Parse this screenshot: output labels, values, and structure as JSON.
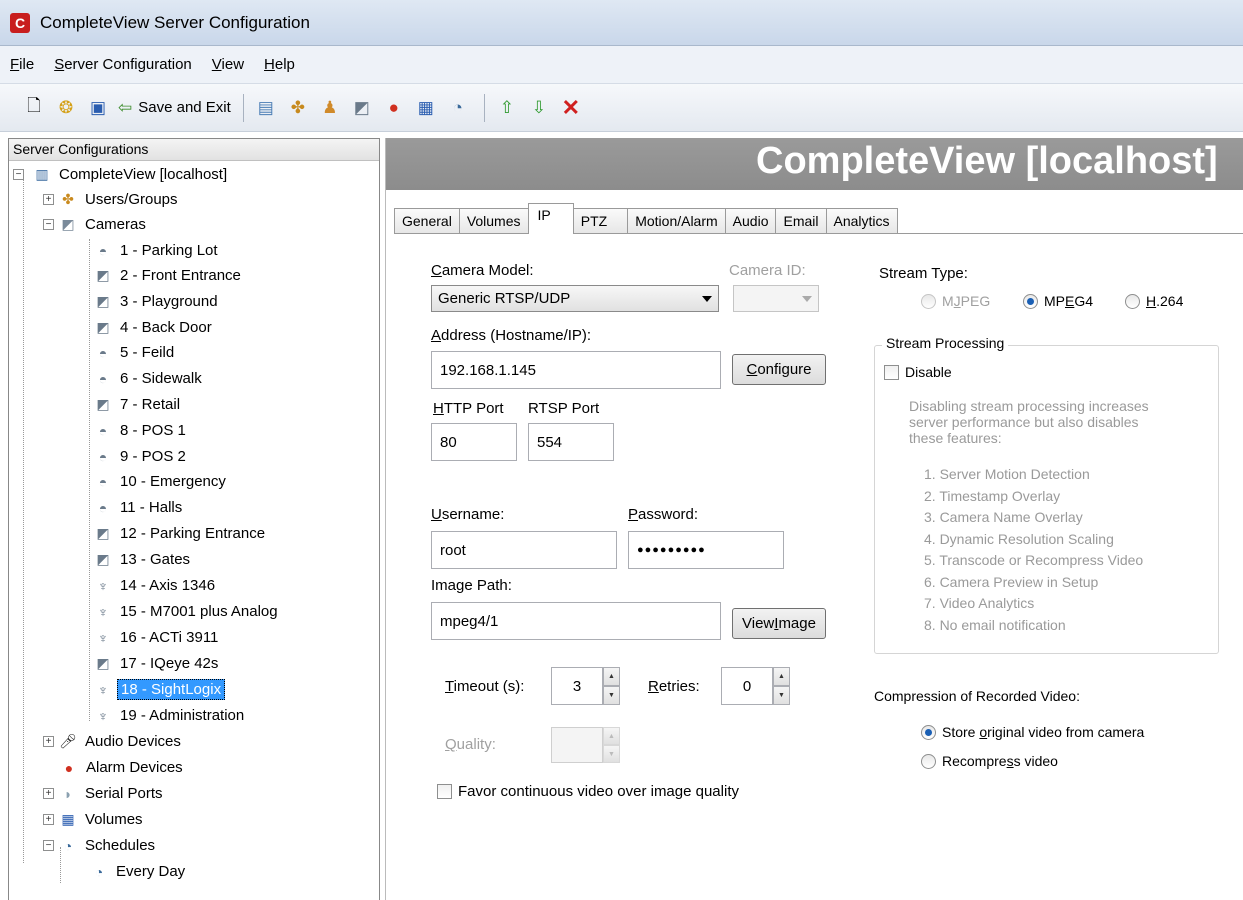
{
  "window": {
    "title": "CompleteView Server Configuration"
  },
  "menu": {
    "file": {
      "ul": "F",
      "rest": "ile"
    },
    "server": {
      "ul": "S",
      "rest": "erver Configuration"
    },
    "view": {
      "ul": "V",
      "rest": "iew"
    },
    "help": {
      "ul": "H",
      "rest": "elp"
    }
  },
  "toolbar": {
    "save_exit_label": "Save and Exit"
  },
  "tree": {
    "header": "Server Configurations",
    "root": "CompleteView [localhost]",
    "users": "Users/Groups",
    "cameras": "Cameras",
    "camera_items": [
      "1 - Parking Lot",
      "2 - Front Entrance",
      "3 - Playground",
      "4 - Back Door",
      "5 - Feild",
      "6 - Sidewalk",
      "7 - Retail",
      "8 - POS 1",
      "9 - POS 2",
      "10 - Emergency",
      "11 - Halls",
      "12 - Parking Entrance",
      "13 - Gates",
      "14 - Axis 1346",
      "15 - M7001 plus Analog",
      "16 - ACTi 3911",
      "17 - IQeye 42s",
      "18 - SightLogix",
      "19 - Administration"
    ],
    "audio": "Audio Devices",
    "alarm": "Alarm Devices",
    "serial": "Serial Ports",
    "volumes": "Volumes",
    "schedules": "Schedules",
    "every_day": "Every Day"
  },
  "banner": {
    "title": "CompleteView [localhost]"
  },
  "tabs": [
    "General",
    "Volumes",
    "IP",
    "PTZ",
    "Motion/Alarm",
    "Audio",
    "Email",
    "Analytics"
  ],
  "form": {
    "camera_model_label": {
      "ul": "C",
      "rest": "amera Model:"
    },
    "camera_model_value": "Generic RTSP/UDP",
    "camera_id_label": "Camera ID:",
    "address_label": {
      "ul": "A",
      "rest": "ddress (Hostname/IP):"
    },
    "address_value": "192.168.1.145",
    "configure_label": {
      "ul": "C",
      "rest": "onfigure"
    },
    "http_port_label": {
      "ul": "H",
      "rest": "TTP Port"
    },
    "http_port_value": "80",
    "rtsp_port_label": "RTSP Port",
    "rtsp_port_value": "554",
    "username_label": {
      "ul": "U",
      "rest": "sername:"
    },
    "username_value": "root",
    "password_label": {
      "ul": "P",
      "rest": "assword:"
    },
    "password_value": "●●●●●●●●●",
    "image_path_label": {
      "pre": "Ima",
      "ul": "g",
      "rest": "e Path:"
    },
    "image_path_value": "mpeg4/1",
    "view_image_label": {
      "pre": "View ",
      "ul": "I",
      "rest": "mage"
    },
    "timeout_label": {
      "ul": "T",
      "rest": "imeout (s):"
    },
    "timeout_value": "3",
    "retries_label": {
      "ul": "R",
      "rest": "etries:"
    },
    "retries_value": "0",
    "quality_label": {
      "ul": "Q",
      "rest": "uality:"
    },
    "favor_label": "Favor continuous video over image quality"
  },
  "stream": {
    "type_label": "Stream Type:",
    "mjpeg": {
      "pre": "M",
      "ul": "J",
      "rest": "PEG"
    },
    "mpeg4": {
      "pre": "MP",
      "ul": "E",
      "rest": "G4"
    },
    "h264": {
      "ul": "H",
      "rest": ".264"
    },
    "processing_title": "Stream Processing",
    "disable_label": "Disable",
    "description": [
      "Disabling stream processing increases",
      "server performance but also disables",
      "these features:"
    ],
    "features": [
      "1. Server Motion Detection",
      "2. Timestamp Overlay",
      "3. Camera Name Overlay",
      "4. Dynamic Resolution Scaling",
      "5. Transcode or Recompress Video",
      "6. Camera Preview in Setup",
      "7. Video Analytics",
      "8. No email notification"
    ]
  },
  "compression": {
    "title": "Compression of Recorded Video:",
    "store": {
      "pre": "Store ",
      "ul": "o",
      "rest": "riginal video from camera"
    },
    "recompress": {
      "pre": "Recompre",
      "ul": "s",
      "rest": "s video"
    }
  }
}
